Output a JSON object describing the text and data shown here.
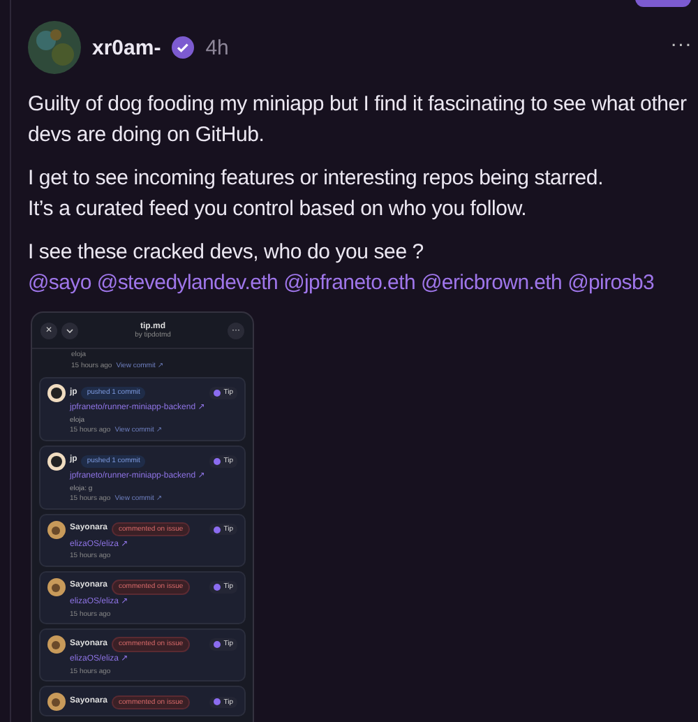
{
  "post": {
    "author": "xr0am-",
    "verified": true,
    "time": "4h",
    "more": "...",
    "paragraphs": [
      "Guilty of dog fooding my miniapp but I find it fascinating to see what other devs are doing on GitHub.",
      "I get to see incoming features or interesting repos being starred.\nIt’s a curated feed you control based on who you follow.",
      "I see these cracked devs, who do you see ?"
    ],
    "mentions": [
      "@sayo",
      "@stevedylandev.eth",
      "@jpfraneto.eth",
      "@ericbrown.eth",
      "@pirosb3"
    ]
  },
  "embed": {
    "title": "tip.md",
    "subtitle": "by tipdotmd",
    "close": "✕",
    "more": "···",
    "partial": {
      "message": "eloja",
      "time": "15 hours ago",
      "link": "View commit ↗"
    },
    "cards": [
      {
        "kind": "commit",
        "user": "jp",
        "action": "pushed 1 commit",
        "tip": "Tip",
        "repo": "jpfraneto/runner-miniapp-backend ↗",
        "message": "eloja",
        "time": "15 hours ago",
        "link": "View commit ↗"
      },
      {
        "kind": "commit",
        "user": "jp",
        "action": "pushed 1 commit",
        "tip": "Tip",
        "repo": "jpfraneto/runner-miniapp-backend ↗",
        "message": "eloja: g",
        "time": "15 hours ago",
        "link": "View commit ↗"
      },
      {
        "kind": "issue",
        "user": "Sayonara",
        "action": "commented on issue",
        "tip": "Tip",
        "repo": "elizaOS/eliza ↗",
        "time": "15 hours ago"
      },
      {
        "kind": "issue",
        "user": "Sayonara",
        "action": "commented on issue",
        "tip": "Tip",
        "repo": "elizaOS/eliza ↗",
        "time": "15 hours ago"
      },
      {
        "kind": "issue",
        "user": "Sayonara",
        "action": "commented on issue",
        "tip": "Tip",
        "repo": "elizaOS/eliza ↗",
        "time": "15 hours ago"
      },
      {
        "kind": "issue",
        "user": "Sayonara",
        "action": "commented on issue",
        "tip": "Tip"
      }
    ]
  }
}
